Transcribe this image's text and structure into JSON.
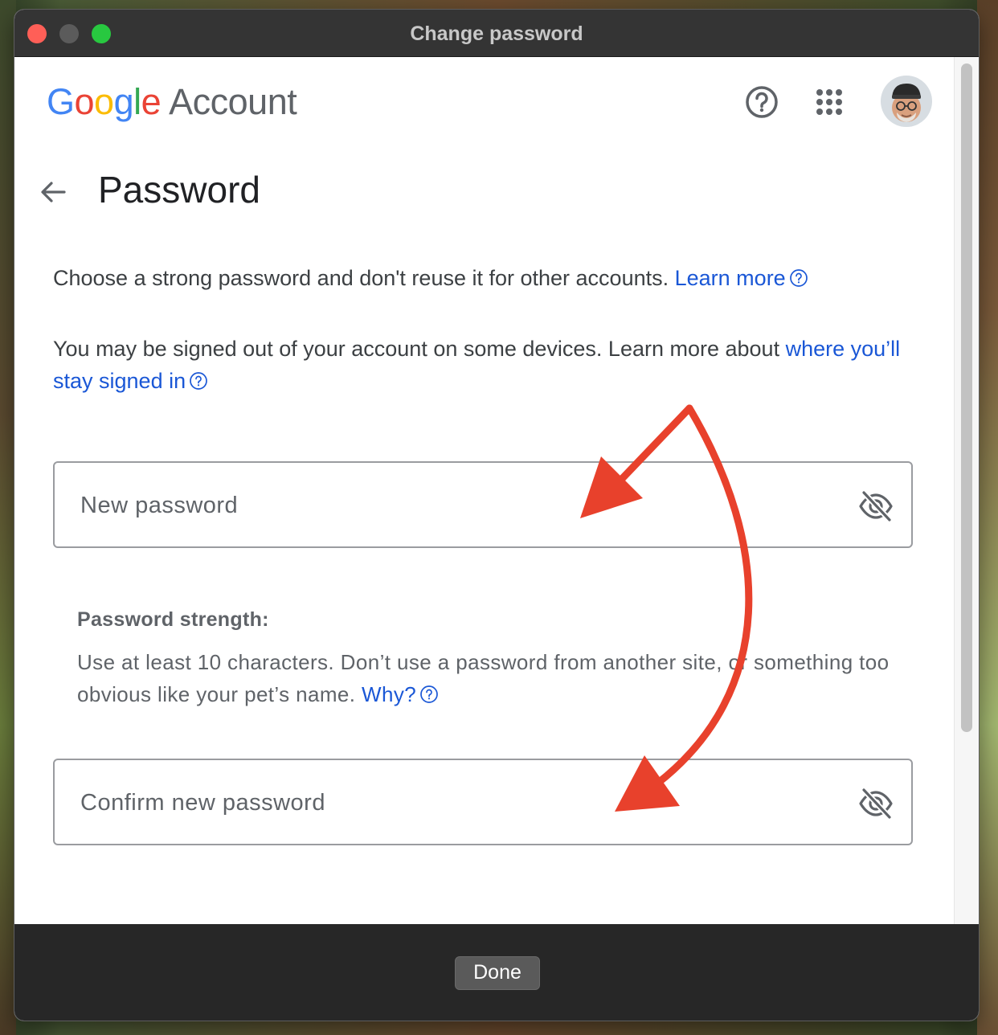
{
  "window": {
    "title": "Change password"
  },
  "header": {
    "logo_letters": [
      "G",
      "o",
      "o",
      "g",
      "l",
      "e"
    ],
    "logo_suffix": "Account",
    "help_icon": "help-circle-icon",
    "apps_icon": "apps-grid-icon",
    "avatar": "user-avatar"
  },
  "page": {
    "title": "Password",
    "back_icon": "arrow-back-icon"
  },
  "intro": {
    "text": "Choose a strong password and don't reuse it for other accounts.",
    "link": "Learn more"
  },
  "signout_note": {
    "text": "You may be signed out of your account on some devices. Learn more about",
    "link": "where you’ll stay signed in"
  },
  "fields": {
    "new_password": {
      "placeholder": "New password",
      "value": "",
      "toggle_icon": "eye-off-icon"
    },
    "confirm_password": {
      "placeholder": "Confirm new password",
      "value": "",
      "toggle_icon": "eye-off-icon"
    }
  },
  "strength": {
    "title": "Password strength:",
    "text": "Use at least 10 characters. Don’t use a password from another site, or something too obvious like your pet’s name.",
    "link": "Why?"
  },
  "footer": {
    "done_label": "Done"
  },
  "colors": {
    "link": "#1a57d6",
    "annotation_arrow": "#e8412c",
    "titlebar": "#343434",
    "bottom_bar": "#272727"
  }
}
